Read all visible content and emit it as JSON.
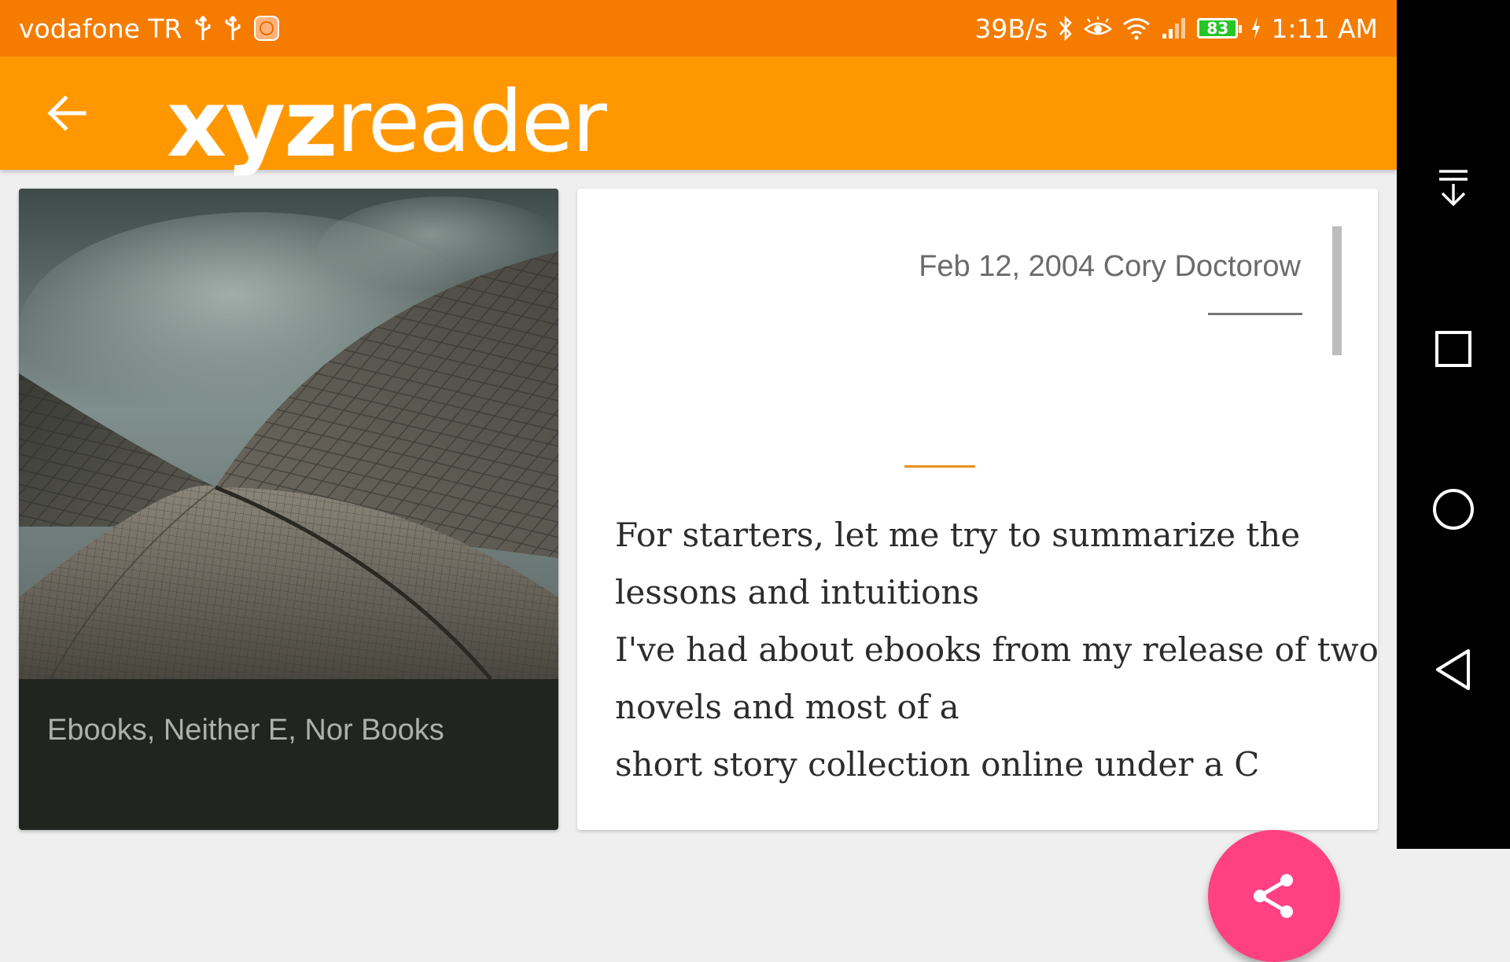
{
  "status_bar": {
    "carrier": "vodafone TR",
    "net_speed": "39B/s",
    "battery_level": "83",
    "time": "1:11 AM",
    "background_color": "#f57c00",
    "icons": [
      "usb-icon",
      "usb-icon",
      "mi-app-icon",
      "bluetooth-icon",
      "eye-icon",
      "wifi-icon",
      "signal-icon",
      "battery-icon",
      "charging-icon"
    ]
  },
  "app_bar": {
    "logo_bold": "xyz",
    "logo_regular": "reader",
    "background_color": "#ff9800",
    "back_icon": "arrow-back-icon"
  },
  "article_list": {
    "items": [
      {
        "title": "Ebooks, Neither E, Nor Books"
      }
    ]
  },
  "article": {
    "byline": "Feb 12, 2004 Cory Doctorow",
    "accent_color": "#e8901a",
    "body_lines": [
      "For starters, let me try to summarize the",
      "lessons and intuitions",
      "I've had about ebooks from my release of two",
      "novels and most of a",
      "short story collection online under a C"
    ]
  },
  "fab": {
    "icon": "share-icon",
    "color": "#ff4081"
  },
  "nav_bar": {
    "buttons": [
      "notification-pull-icon",
      "recents-icon",
      "home-icon",
      "back-icon"
    ]
  }
}
